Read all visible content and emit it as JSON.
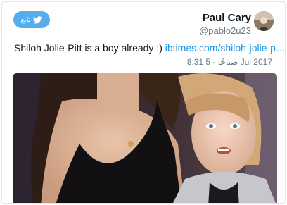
{
  "tweet": {
    "author_name": "Paul Cary",
    "author_handle": "@pablo2u23",
    "follow_label": "تابع",
    "text": "Shiloh Jolie-Pitt is a boy already :)",
    "link_text": "ibtimes.com/shiloh-jolie-p…",
    "timestamp": "8:31 صباحًا - 5 Jul 2017"
  },
  "icons": {
    "follow": "twitter-bird-icon",
    "avatar": "avatar"
  },
  "colors": {
    "accent": "#55acee",
    "link": "#1b95e0",
    "text": "#14171a",
    "muted": "#657786"
  }
}
